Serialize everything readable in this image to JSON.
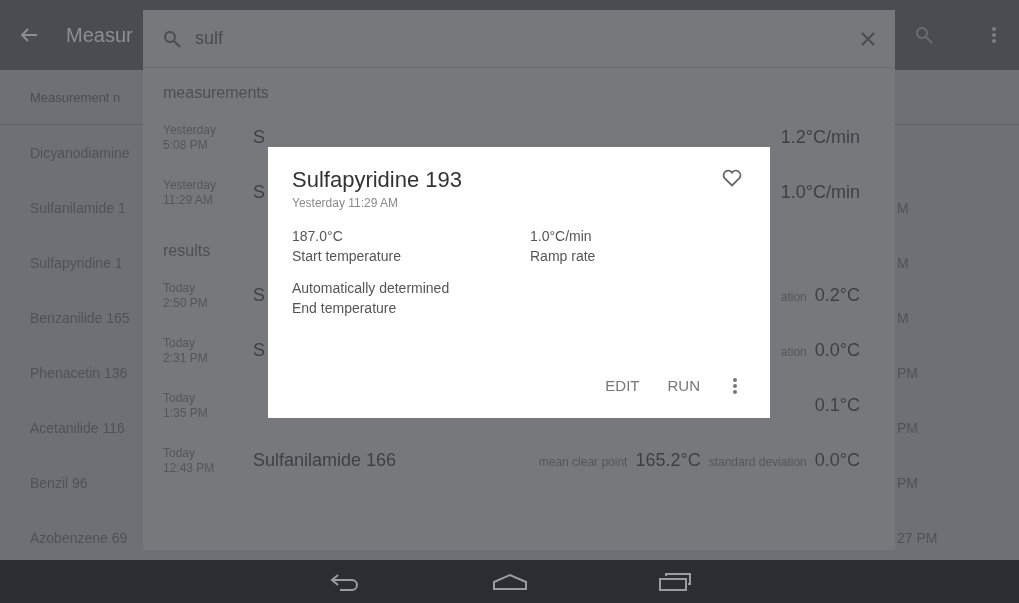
{
  "app_bar": {
    "title": "Measur"
  },
  "list_header": "Measurement n",
  "list_rows": [
    {
      "name": "Dicyanodiamine"
    },
    {
      "name": "Sulfanilamide 1",
      "time": "M"
    },
    {
      "name": "Sulfapyridine 1",
      "time": "M"
    },
    {
      "name": "Benzanilide 165",
      "time": "M"
    },
    {
      "name": "Phenacetin 136",
      "time": "PM"
    },
    {
      "name": "Acetanilide 116",
      "time": "PM"
    },
    {
      "name": "Benzil 96",
      "time": "PM"
    },
    {
      "name": "Azobenzene 69",
      "time": "27 PM"
    }
  ],
  "search": {
    "query": "sulf",
    "sections": [
      {
        "title": "measurements",
        "rows": [
          {
            "day": "Yesterday",
            "time": "5:08 PM",
            "title": "S",
            "tail": [
              {
                "kind": "value",
                "text": "1.2°C/min"
              }
            ]
          },
          {
            "day": "Yesterday",
            "time": "11:29 AM",
            "title": "S",
            "tail": [
              {
                "kind": "value",
                "text": "1.0°C/min"
              }
            ]
          }
        ]
      },
      {
        "title": "results",
        "rows": [
          {
            "day": "Today",
            "time": "2:50 PM",
            "title": "S",
            "tail": [
              {
                "kind": "label",
                "text": "ation"
              },
              {
                "kind": "value",
                "text": "0.2°C"
              }
            ]
          },
          {
            "day": "Today",
            "time": "2:31 PM",
            "title": "S",
            "tail": [
              {
                "kind": "label",
                "text": "ation"
              },
              {
                "kind": "value",
                "text": "0.0°C"
              }
            ]
          },
          {
            "day": "Today",
            "time": "1:35 PM",
            "tail": [
              {
                "kind": "value",
                "text": "0.1°C"
              }
            ]
          },
          {
            "day": "Today",
            "time": "12:43 PM",
            "title": "Sulfanilamide 166",
            "tail": [
              {
                "kind": "label",
                "text": "mean clear point"
              },
              {
                "kind": "value",
                "text": "165.2°C"
              },
              {
                "kind": "label",
                "text": "standard deviation"
              },
              {
                "kind": "value",
                "text": "0.0°C"
              }
            ]
          }
        ]
      }
    ]
  },
  "dialog": {
    "title": "Sulfapyridine 193",
    "subtitle": "Yesterday 11:29 AM",
    "favorite": false,
    "fields": [
      {
        "value": "187.0°C",
        "label": "Start temperature"
      },
      {
        "value": "1.0°C/min",
        "label": "Ramp rate"
      },
      {
        "value": "Automatically determined",
        "label": "End temperature"
      }
    ],
    "actions": [
      "EDIT",
      "RUN"
    ]
  }
}
